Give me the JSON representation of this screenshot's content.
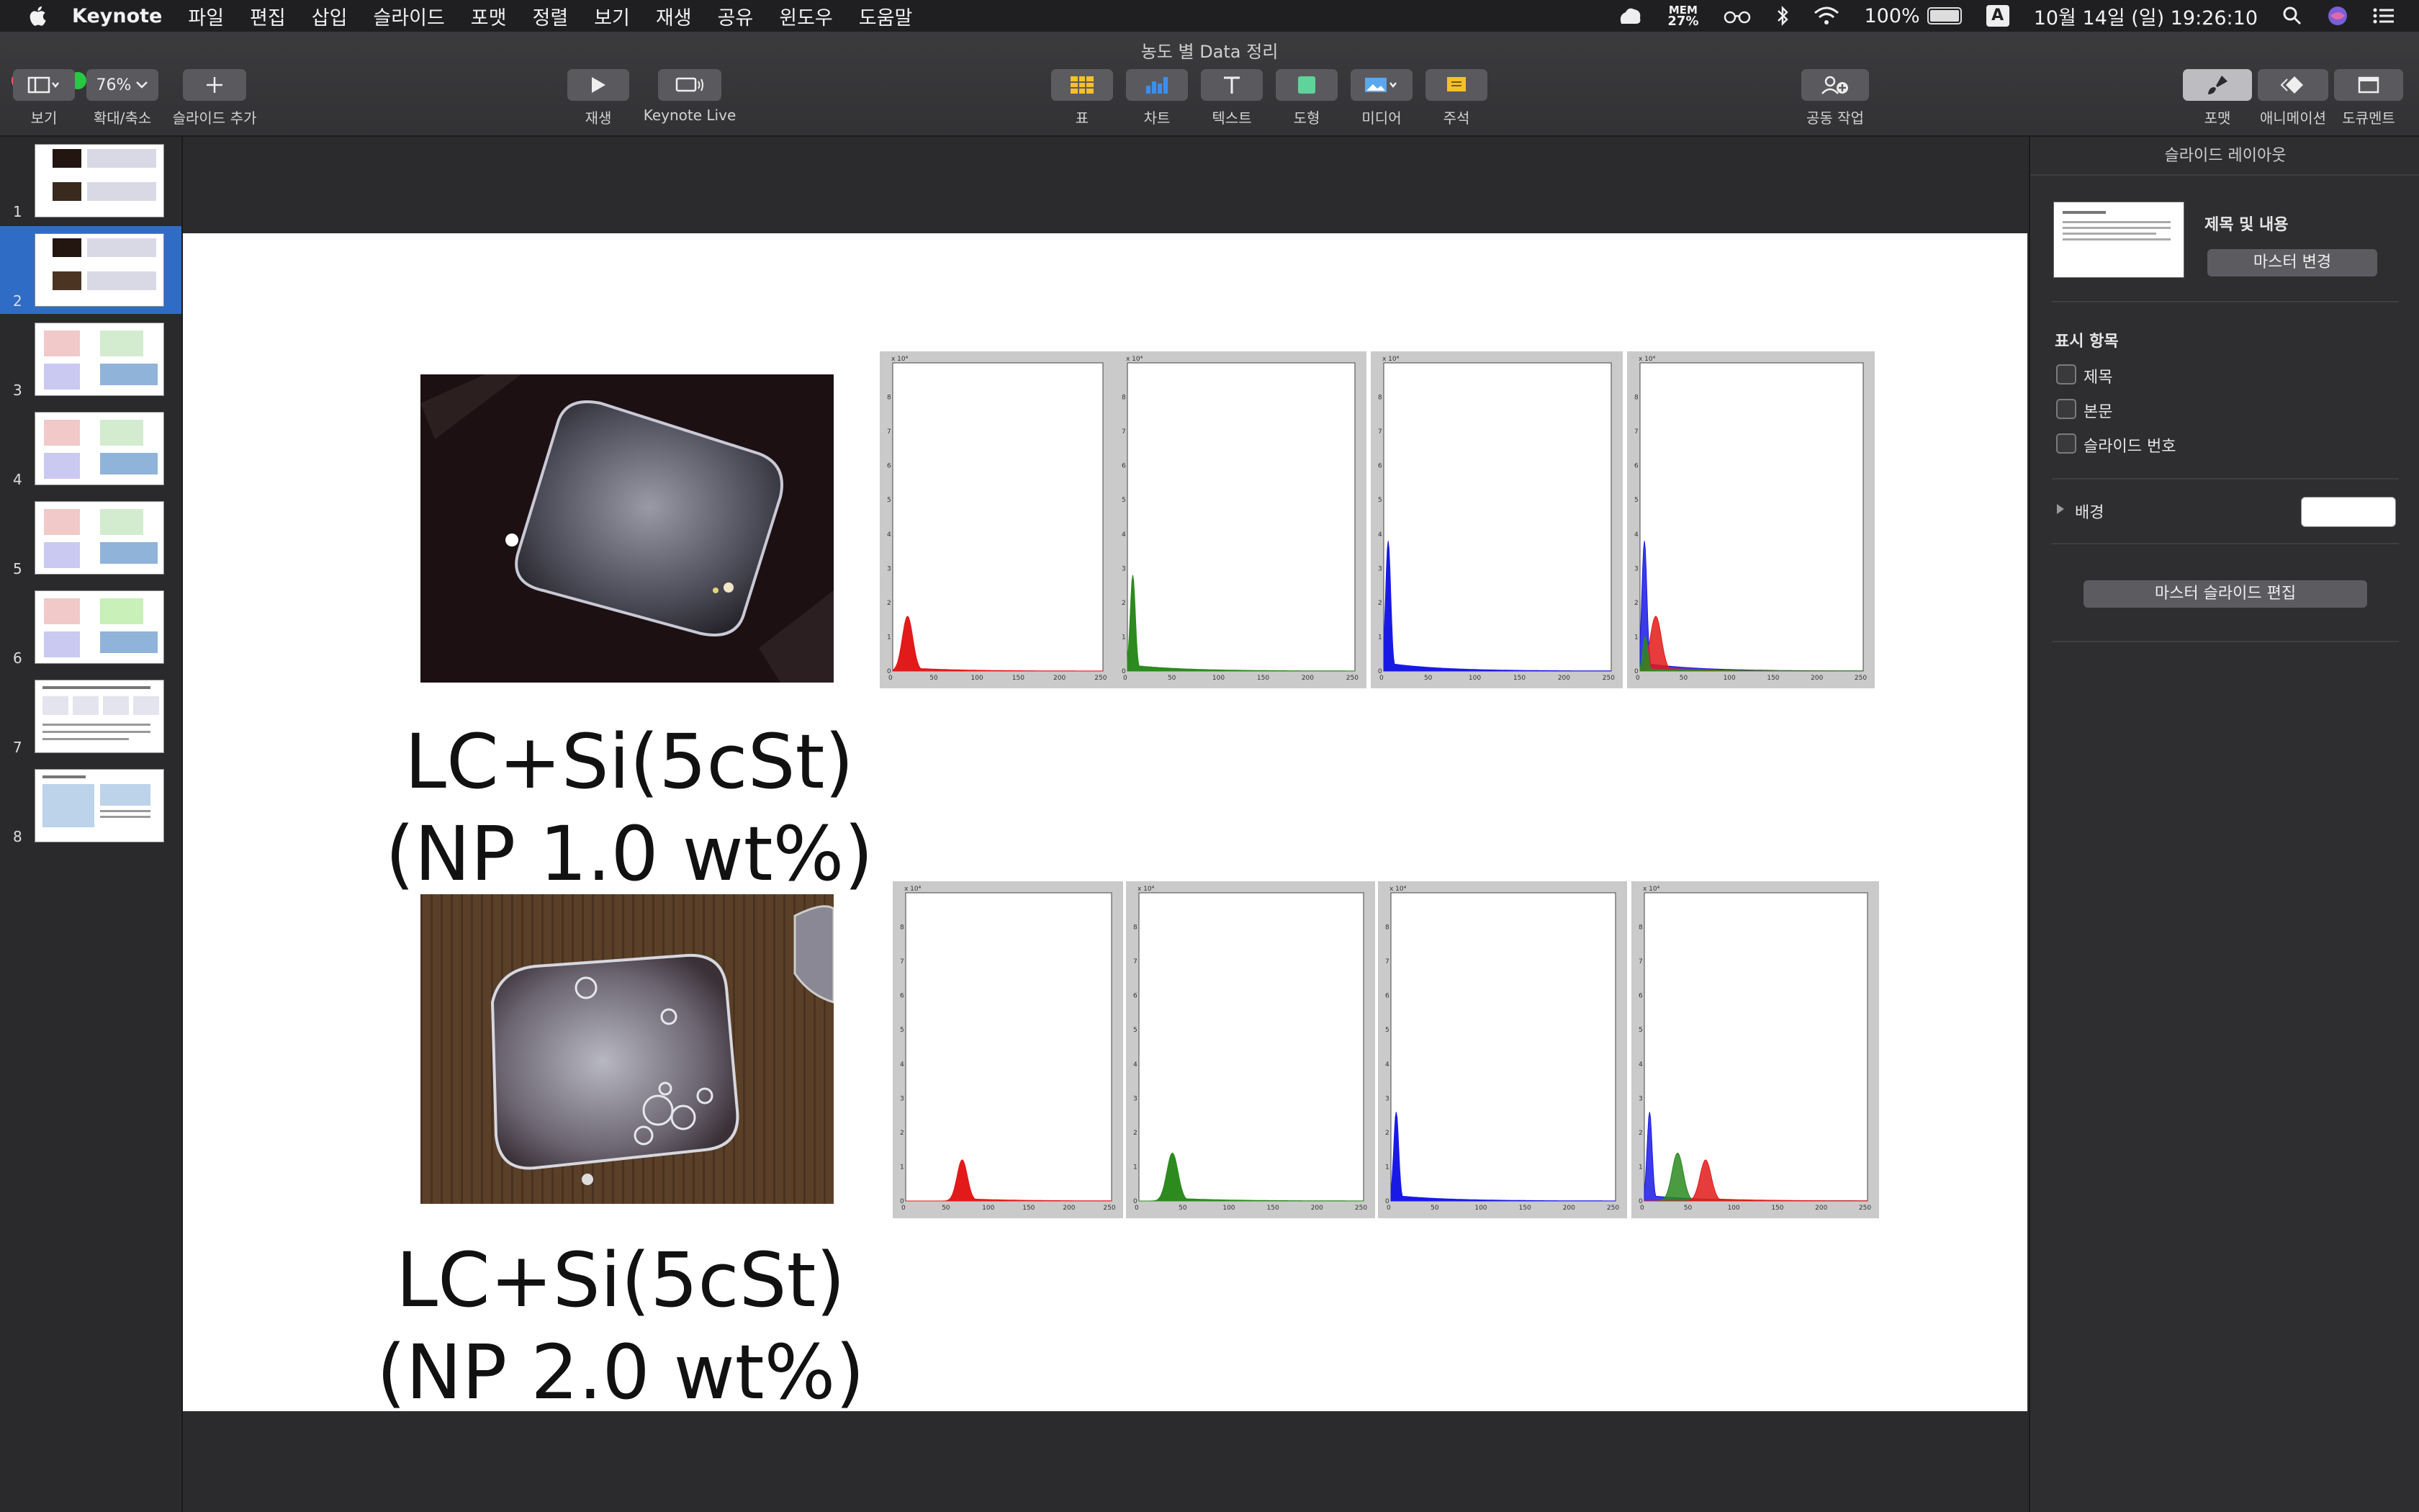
{
  "menubar": {
    "app_name": "Keynote",
    "items": [
      "파일",
      "편집",
      "삽입",
      "슬라이드",
      "포맷",
      "정렬",
      "보기",
      "재생",
      "공유",
      "윈도우",
      "도움말"
    ],
    "mem_label": "MEM",
    "mem_value": "27%",
    "battery": "100%",
    "input_source": "A",
    "datetime": "10월 14일 (일)  19:26:10"
  },
  "window": {
    "title": "농도 별 Data 정리"
  },
  "toolbar": {
    "zoom_value": "76%",
    "view_label": "보기",
    "zoom_label": "확대/축소",
    "add_slide_label": "슬라이드 추가",
    "play_label": "재생",
    "keynote_live_label": "Keynote Live",
    "table_label": "표",
    "chart_label": "차트",
    "text_label": "텍스트",
    "shape_label": "도형",
    "media_label": "미디어",
    "comment_label": "주석",
    "collaborate_label": "공동 작업",
    "format_label": "포맷",
    "animate_label": "애니메이션",
    "document_label": "도큐멘트"
  },
  "navigator": {
    "slides": [
      {
        "number": "1",
        "kind": "photos"
      },
      {
        "number": "2",
        "kind": "photos",
        "selected": true
      },
      {
        "number": "3",
        "kind": "hist-red"
      },
      {
        "number": "4",
        "kind": "hist-blue"
      },
      {
        "number": "5",
        "kind": "hist-mix"
      },
      {
        "number": "6",
        "kind": "hist-mix"
      },
      {
        "number": "7",
        "kind": "text"
      },
      {
        "number": "8",
        "kind": "table"
      }
    ]
  },
  "slide": {
    "caption_top": "LC+Si(5cSt)\n(NP 1.0 wt%)",
    "caption_bottom": "LC+Si(5cSt)\n(NP 2.0 wt%)",
    "axis_exponent": "x 10⁴",
    "x_ticks": [
      "0",
      "50",
      "100",
      "150",
      "200",
      "250"
    ],
    "y_ticks": [
      "0",
      "1",
      "2",
      "3",
      "4",
      "5",
      "6",
      "7",
      "8"
    ]
  },
  "chart_data": [
    {
      "type": "area",
      "row": "NP 1.0 wt%",
      "channel": "red",
      "color": "#e21a1a",
      "peak_x": 18,
      "peak_y": 1.6,
      "x_range": [
        0,
        255
      ],
      "y_range": [
        0,
        9
      ]
    },
    {
      "type": "area",
      "row": "NP 1.0 wt%",
      "channel": "green",
      "color": "#2c8a1e",
      "peak_x": 6,
      "peak_y": 2.8,
      "x_range": [
        0,
        255
      ],
      "y_range": [
        0,
        9
      ]
    },
    {
      "type": "area",
      "row": "NP 1.0 wt%",
      "channel": "blue",
      "color": "#1919e6",
      "peak_x": 5,
      "peak_y": 3.8,
      "x_range": [
        0,
        255
      ],
      "y_range": [
        0,
        9
      ]
    },
    {
      "type": "area",
      "row": "NP 1.0 wt%",
      "channel": "combined",
      "series": [
        {
          "name": "blue",
          "peak_x": 5,
          "peak_y": 3.8
        },
        {
          "name": "red",
          "peak_x": 18,
          "peak_y": 1.6
        },
        {
          "name": "green",
          "peak_x": 6,
          "peak_y": 1.0
        }
      ],
      "x_range": [
        0,
        255
      ],
      "y_range": [
        0,
        9
      ]
    },
    {
      "type": "area",
      "row": "NP 2.0 wt%",
      "channel": "red",
      "color": "#e21a1a",
      "peak_x": 70,
      "peak_y": 1.2,
      "x_range": [
        0,
        255
      ],
      "y_range": [
        0,
        9
      ]
    },
    {
      "type": "area",
      "row": "NP 2.0 wt%",
      "channel": "green",
      "color": "#2c8a1e",
      "peak_x": 38,
      "peak_y": 1.4,
      "x_range": [
        0,
        255
      ],
      "y_range": [
        0,
        9
      ]
    },
    {
      "type": "area",
      "row": "NP 2.0 wt%",
      "channel": "blue",
      "color": "#1919e6",
      "peak_x": 6,
      "peak_y": 2.6,
      "x_range": [
        0,
        255
      ],
      "y_range": [
        0,
        9
      ]
    },
    {
      "type": "area",
      "row": "NP 2.0 wt%",
      "channel": "combined",
      "series": [
        {
          "name": "blue",
          "peak_x": 6,
          "peak_y": 2.6
        },
        {
          "name": "green",
          "peak_x": 38,
          "peak_y": 1.4
        },
        {
          "name": "red",
          "peak_x": 70,
          "peak_y": 1.2
        }
      ],
      "x_range": [
        0,
        255
      ],
      "y_range": [
        0,
        9
      ]
    }
  ],
  "inspector": {
    "title": "슬라이드 레이아웃",
    "layout_name": "제목 및 내용",
    "change_master_label": "마스터 변경",
    "appearance_heading": "표시 항목",
    "title_checkbox": "제목",
    "body_checkbox": "본문",
    "slide_number_checkbox": "슬라이드 번호",
    "background_label": "배경",
    "edit_master_label": "마스터 슬라이드 편집"
  }
}
